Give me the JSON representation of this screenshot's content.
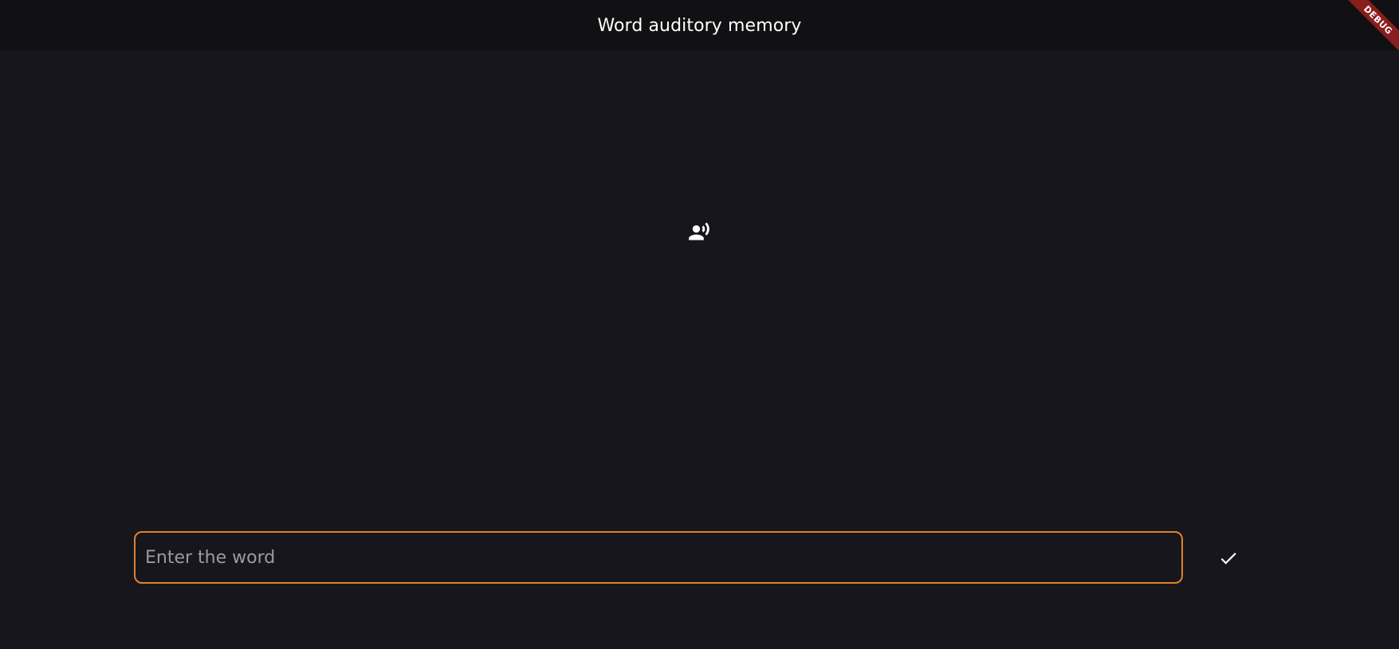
{
  "app_bar": {
    "title": "Word auditory memory"
  },
  "debug_banner": {
    "label": "DEBUG"
  },
  "speaker": {
    "icon": "record-voice-over-icon"
  },
  "word_input": {
    "value": "",
    "placeholder": "Enter the word"
  },
  "submit": {
    "icon": "check-icon"
  },
  "colors": {
    "background": "#17161d",
    "app_bar": "#111113",
    "accent": "#e0822b",
    "debug": "#8a1d1d"
  }
}
